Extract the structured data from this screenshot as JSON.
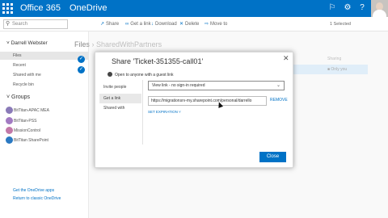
{
  "suite": {
    "brand": "Office 365",
    "app": "OneDrive",
    "icons": [
      "bell-icon",
      "gear-icon",
      "help-icon"
    ]
  },
  "commands": {
    "search_placeholder": "Search",
    "share": "Share",
    "get_link": "Get a link",
    "download": "Download",
    "delete": "Delete",
    "move_to": "Move to",
    "selected": "1 Selected"
  },
  "leftnav": {
    "user": "Darrell Webster",
    "items": [
      "Files",
      "Recent",
      "Shared with me",
      "Recycle bin"
    ],
    "groups_header": "Groups",
    "groups": [
      {
        "label": "BitTitan-APAC MEA",
        "color": "#8a7ab8"
      },
      {
        "label": "BitTitan-PSS",
        "color": "#a27ac2"
      },
      {
        "label": "MissionControl",
        "color": "#c278a8"
      },
      {
        "label": "BitTitan SharePoint",
        "color": "#2b79c2"
      }
    ],
    "bottom_links": [
      "Get the OneDrive apps",
      "Return to classic OneDrive"
    ]
  },
  "main": {
    "breadcrumb": [
      "Files",
      "SharedWithPartners"
    ],
    "sharing_header": "Sharing",
    "sharing_value": "Only you"
  },
  "dialog": {
    "title": "Share 'Ticket-351355-call01'",
    "open_to_anyone": "Open to anyone with a guest link",
    "tabs": [
      "Invite people",
      "Get a link",
      "Shared with"
    ],
    "select_value": "View link - no sign-in required",
    "link_url": "https://migrationsrv-my.sharepoint.com/personal/darrello",
    "remove": "REMOVE",
    "set_expiration": "SET EXPIRATION",
    "close": "Close"
  }
}
